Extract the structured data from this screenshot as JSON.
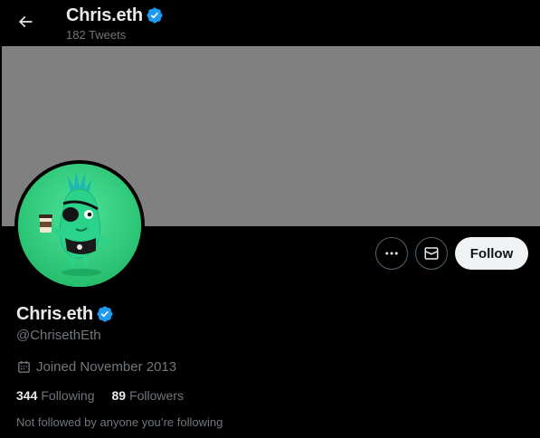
{
  "header": {
    "back_icon": "arrow-left-icon",
    "name": "Chris.eth",
    "verified_icon": "verified-badge-icon",
    "tweet_count": "182 Tweets"
  },
  "banner": {
    "color": "#808080"
  },
  "avatar": {
    "background": "#2fcf7e"
  },
  "actions": {
    "more_icon": "more-dots-icon",
    "message_icon": "envelope-icon",
    "follow_label": "Follow"
  },
  "profile": {
    "name": "Chris.eth",
    "handle": "@ChrisethEth",
    "joined_icon": "calendar-icon",
    "joined": "Joined November 2013",
    "following_count": "344",
    "following_label": "Following",
    "followers_count": "89",
    "followers_label": "Followers",
    "not_followed_text": "Not followed by anyone you’re following"
  },
  "colors": {
    "background": "#000000",
    "text_primary": "#e7e9ea",
    "text_secondary": "#71767b",
    "verified_blue": "#1d9bf0",
    "follow_bg": "#eff3f4"
  }
}
